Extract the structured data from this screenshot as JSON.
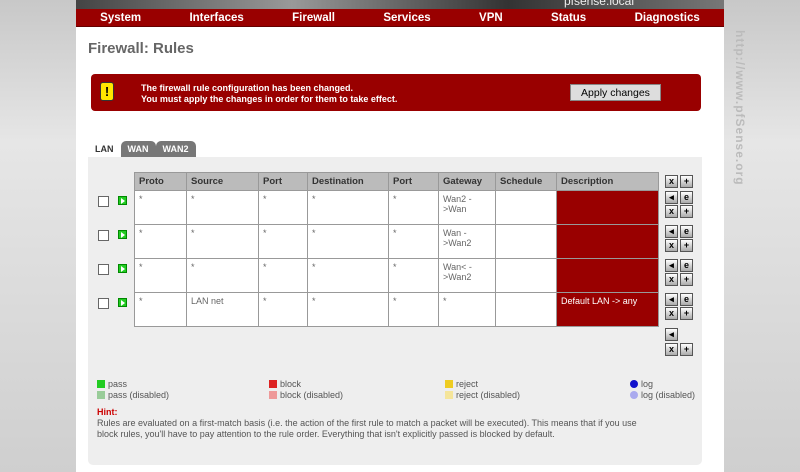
{
  "header": {
    "hostname": "pfsense.local"
  },
  "nav": [
    "System",
    "Interfaces",
    "Firewall",
    "Services",
    "VPN",
    "Status",
    "Diagnostics"
  ],
  "page_title": "Firewall: Rules",
  "alert": {
    "line1": "The firewall rule configuration has been changed.",
    "line2": "You must apply the changes in order for them to take effect.",
    "button": "Apply changes"
  },
  "watermark": "http://www.pfSense.org",
  "tabs": [
    "LAN",
    "WAN",
    "WAN2"
  ],
  "columns": [
    "Proto",
    "Source",
    "Port",
    "Destination",
    "Port",
    "Gateway",
    "Schedule",
    "Description"
  ],
  "rows": [
    [
      "*",
      "*",
      "*",
      "*",
      "*",
      "Wan2 ->Wan",
      "",
      ""
    ],
    [
      "*",
      "*",
      "*",
      "*",
      "*",
      "Wan ->Wan2",
      "",
      ""
    ],
    [
      "*",
      "*",
      "*",
      "*",
      "*",
      "Wan< ->Wan2",
      "",
      ""
    ],
    [
      "*",
      "LAN net",
      "*",
      "*",
      "*",
      "*",
      "",
      "Default LAN -> any"
    ]
  ],
  "legend": {
    "pass": "pass",
    "pass_disabled": "pass (disabled)",
    "block": "block",
    "block_disabled": "block (disabled)",
    "reject": "reject",
    "reject_disabled": "reject (disabled)",
    "log": "log",
    "log_disabled": "log (disabled)"
  },
  "hint": {
    "title": "Hint:",
    "text": "Rules are evaluated on a first-match basis (i.e. the action of the first rule to match a packet will be executed). This means that if you use block rules, you'll have to pay attention to the rule order. Everything that isn't explicitly passed is blocked by default."
  },
  "colors": {
    "brand": "#990000"
  }
}
